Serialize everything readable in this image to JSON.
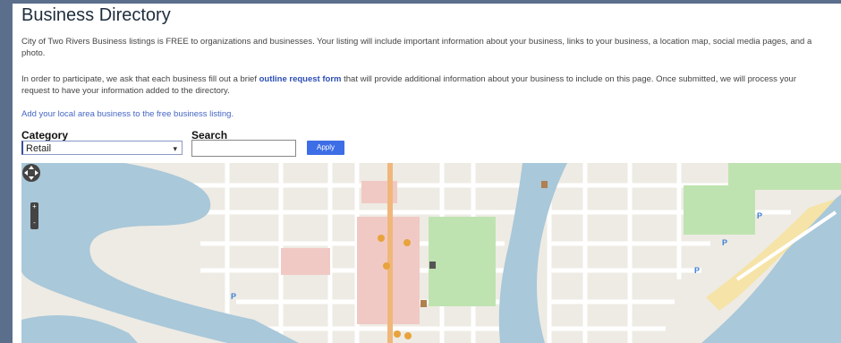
{
  "page": {
    "title": "Business Directory",
    "intro": "City of Two Rivers Business listings is FREE to organizations and businesses. Your listing will include important information about your business, links to your business, a location map, social media pages, and a photo.",
    "participate_before": "In order to participate, we ask that each business fill out a brief ",
    "participate_link": "outline request form",
    "participate_after": " that will provide additional information about your business to include on this page. Once submitted, we will process your request to have your information added to the directory.",
    "add_link": "Add your local area business to the free business listing."
  },
  "filters": {
    "category_label": "Category",
    "category_value": "Retail",
    "search_label": "Search",
    "search_value": "",
    "apply_label": "Apply"
  },
  "map": {
    "zoom_in": "+",
    "zoom_out": "-",
    "colors": {
      "land": "#eeebe4",
      "water": "#a9c8d9",
      "park": "#bfe3b0",
      "commercial": "#f1c9c4",
      "main_road": "#f0b77b",
      "beach": "#f5e3a8",
      "marker": "#e8a33c",
      "parking": "#3d7fd6"
    },
    "icons": [
      "pan-control-icon",
      "zoom-in-icon",
      "zoom-out-icon",
      "marker-icon",
      "parking-icon"
    ]
  }
}
